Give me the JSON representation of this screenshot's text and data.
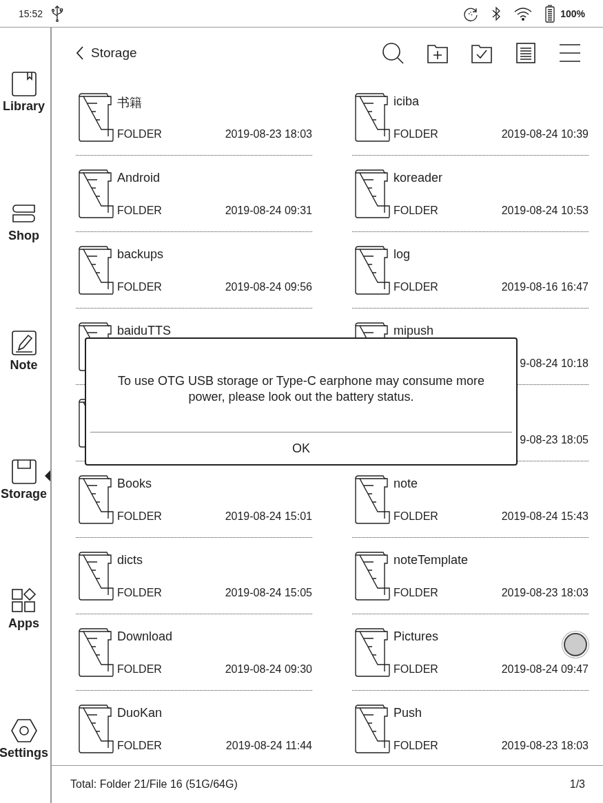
{
  "status_bar": {
    "time": "15:52",
    "battery": "100%"
  },
  "sidebar": {
    "items": [
      {
        "label": "Library",
        "selected": false
      },
      {
        "label": "Shop",
        "selected": false
      },
      {
        "label": "Note",
        "selected": false
      },
      {
        "label": "Storage",
        "selected": true
      },
      {
        "label": "Apps",
        "selected": false
      },
      {
        "label": "Settings",
        "selected": false
      }
    ]
  },
  "header": {
    "back_label": "Storage"
  },
  "files": [
    {
      "kind": "folder",
      "name": "书籍",
      "type": "FOLDER",
      "date": "2019-08-23 18:03"
    },
    {
      "kind": "folder",
      "name": "iciba",
      "type": "FOLDER",
      "date": "2019-08-24 10:39"
    },
    {
      "kind": "folder",
      "name": "Android",
      "type": "FOLDER",
      "date": "2019-08-24 09:31"
    },
    {
      "kind": "folder",
      "name": "koreader",
      "type": "FOLDER",
      "date": "2019-08-24 10:53"
    },
    {
      "kind": "folder",
      "name": "backups",
      "type": "FOLDER",
      "date": "2019-08-24 09:56"
    },
    {
      "kind": "folder",
      "name": "log",
      "type": "FOLDER",
      "date": "2019-08-16 16:47"
    },
    {
      "kind": "folder",
      "name": "baiduTTS"
    },
    {
      "kind": "folder",
      "name": "mipush",
      "date": "9-08-24 10:18"
    },
    {
      "kind": "folder"
    },
    {
      "date": "9-08-23 18:05"
    },
    {
      "kind": "folder",
      "name": "Books",
      "type": "FOLDER",
      "date": "2019-08-24 15:01"
    },
    {
      "kind": "folder",
      "name": "note",
      "type": "FOLDER",
      "date": "2019-08-24 15:43"
    },
    {
      "kind": "folder",
      "name": "dicts",
      "type": "FOLDER",
      "date": "2019-08-24 15:05"
    },
    {
      "kind": "folder",
      "name": "noteTemplate",
      "type": "FOLDER",
      "date": "2019-08-23 18:03"
    },
    {
      "kind": "folder",
      "name": "Download",
      "type": "FOLDER",
      "date": "2019-08-24 09:30"
    },
    {
      "kind": "folder",
      "name": "Pictures",
      "type": "FOLDER",
      "date": "2019-08-24 09:47"
    },
    {
      "kind": "folder",
      "name": "DuoKan",
      "type": "FOLDER",
      "date": "2019-08-24 11:44"
    },
    {
      "kind": "folder",
      "name": "Push",
      "type": "FOLDER",
      "date": "2019-08-23 18:03"
    }
  ],
  "dialog": {
    "message": "To use OTG USB storage or Type-C earphone may consume more power, please look out the battery status.",
    "button": "OK"
  },
  "footer": {
    "total": "Total:  Folder 21/File 16  (51G/64G)",
    "page": "1/3"
  }
}
